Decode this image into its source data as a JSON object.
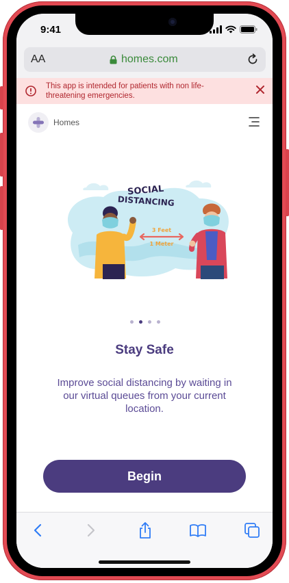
{
  "status_bar": {
    "time": "9:41"
  },
  "browser": {
    "text_size_label": "AA",
    "url": "homes.com"
  },
  "alert": {
    "message": "This app is intended for patients with non life-threatening emergencies."
  },
  "app_header": {
    "brand": "Homes"
  },
  "illustration": {
    "heading_line1": "SOCIAL",
    "heading_line2": "DISTANCING",
    "distance_line1": "3 Feet",
    "distance_line2": "1 Meter"
  },
  "carousel": {
    "total_slides": 4,
    "active_slide": 2
  },
  "onboarding": {
    "title": "Stay Safe",
    "description": "Improve social distancing by waiting in our virtual queues from your current location.",
    "begin_label": "Begin"
  },
  "colors": {
    "primary": "#4b3c7f",
    "alert_bg": "#fde0e0",
    "alert_text": "#b0262e",
    "url_green": "#3a8a3a",
    "ios_blue": "#2f7cf6",
    "phone_frame": "#e24a53"
  },
  "toolbar_icons": [
    "back-icon",
    "forward-icon",
    "share-icon",
    "bookmarks-icon",
    "tabs-icon"
  ]
}
